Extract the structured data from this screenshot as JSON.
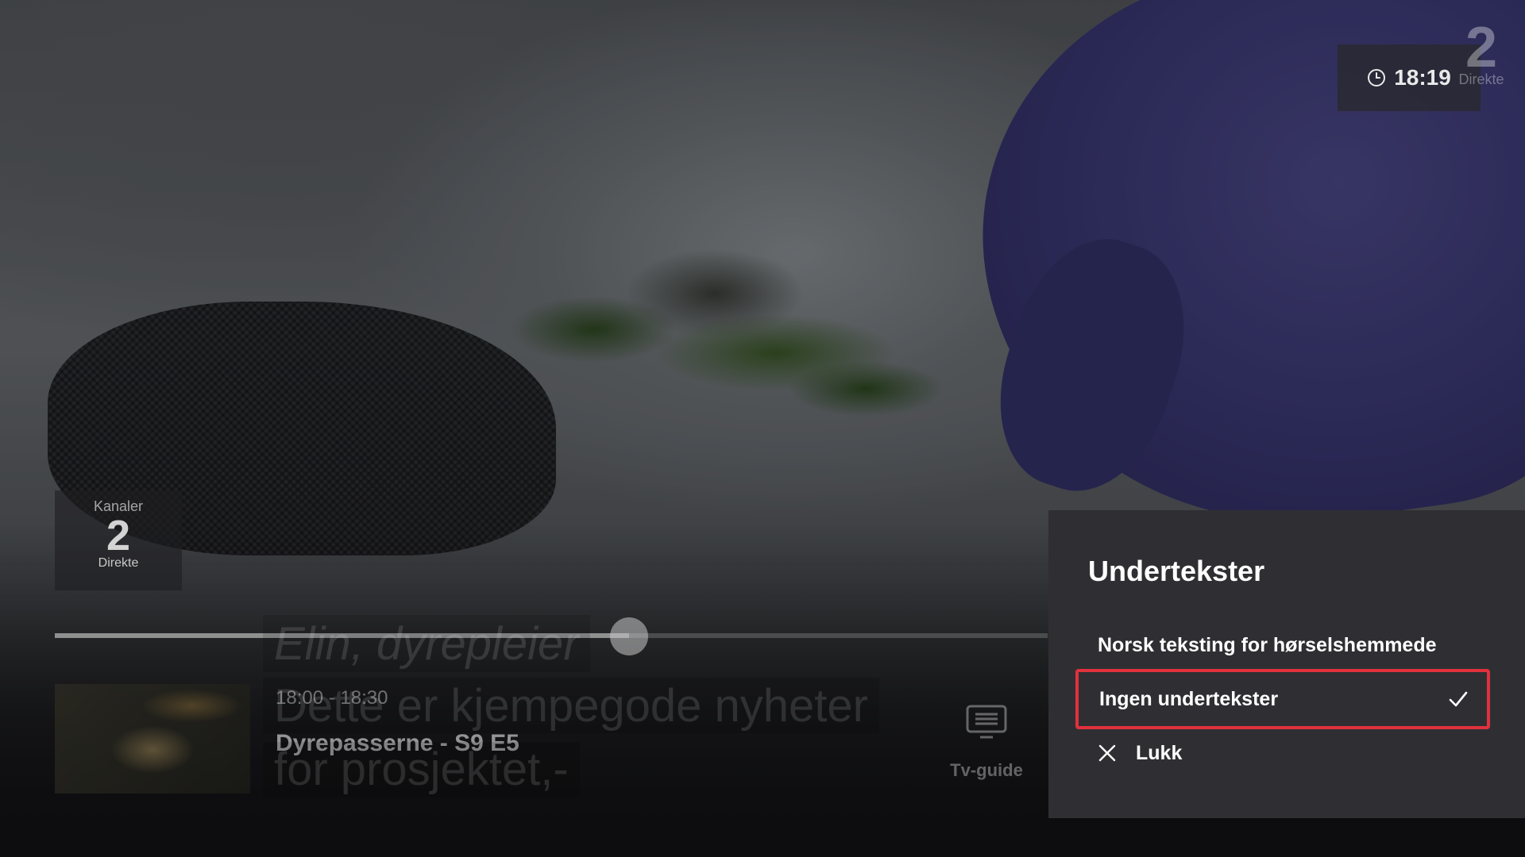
{
  "player": {
    "clock": {
      "time": "18:19"
    },
    "channel_top": {
      "number": "2",
      "label": "Direkte"
    },
    "channel_card": {
      "heading": "Kanaler",
      "number": "2",
      "label": "Direkte"
    },
    "progress": {
      "fraction": 0.578
    },
    "program": {
      "time": "18:00 - 18:30",
      "title": "Dyrepasserne - S9 E5"
    },
    "subtitles_onscreen": [
      "Elin, dyrepleier",
      "Dette er kjempegode nyheter",
      "for prosjektet,-"
    ],
    "tv_guide": {
      "label": "Tv-guide",
      "icon": "tv-guide-icon"
    }
  },
  "subtitle_menu": {
    "title": "Undertekster",
    "options": [
      {
        "label": "Norsk teksting for hørselshemmede",
        "selected": false,
        "focused": false
      },
      {
        "label": "Ingen undertekster",
        "selected": true,
        "focused": true,
        "icon": "check-icon"
      },
      {
        "label": "Lukk",
        "icon": "close-icon"
      }
    ],
    "focus_color": "#e0313d"
  }
}
